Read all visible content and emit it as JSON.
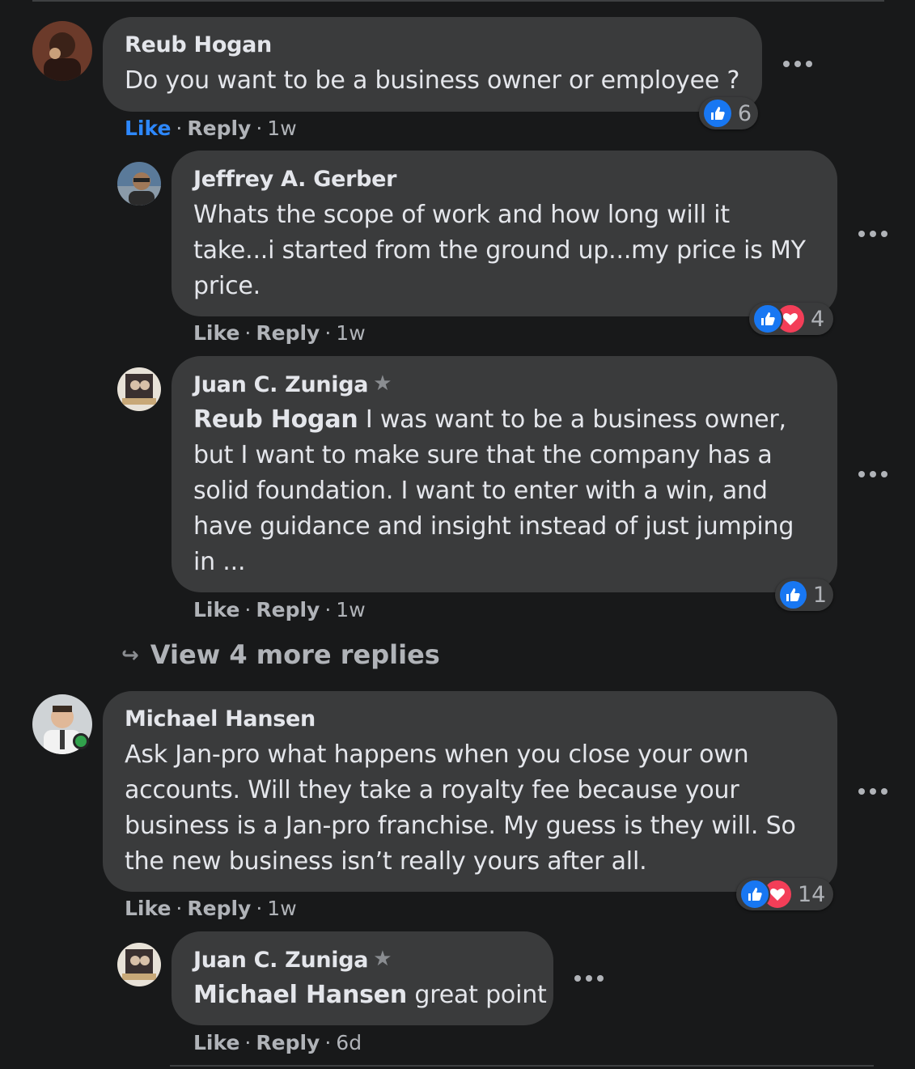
{
  "comments": [
    {
      "author": "Reub Hogan",
      "text": "Do you want to be a business owner or employee ?",
      "like": "Like",
      "reply": "Reply",
      "time": "1w",
      "reaction_count": "6",
      "liked": true
    },
    {
      "author": "Jeffrey A. Gerber",
      "text": "Whats the scope of work and how long will it take...i started from the ground up...my price is MY price.",
      "like": "Like",
      "reply": "Reply",
      "time": "1w",
      "reaction_count": "4"
    },
    {
      "author": "Juan C. Zuniga",
      "mention": "Reub Hogan",
      "text": " I was want to be a business owner, but I want to make sure that the company has a solid foundation. I want to enter with a win, and have guidance and insight instead of just jumping in ...",
      "like": "Like",
      "reply": "Reply",
      "time": "1w",
      "reaction_count": "1"
    },
    {
      "author": "Michael Hansen",
      "text": "Ask Jan-pro what happens when you close your own accounts. Will they take a royalty fee because your business is a Jan-pro franchise. My guess is they will. So the new business isn’t really yours after all.",
      "like": "Like",
      "reply": "Reply",
      "time": "1w",
      "reaction_count": "14"
    },
    {
      "author": "Juan C. Zuniga",
      "mention": "Michael Hansen",
      "text": " great point",
      "like": "Like",
      "reply": "Reply",
      "time": "6d"
    }
  ],
  "view_more_replies": "View 4 more replies",
  "colors": {
    "background": "#18191a",
    "bubble": "#3a3b3c",
    "like_blue": "#1877f2",
    "love_red": "#f33e58",
    "online_green": "#31a24c"
  },
  "icons": [
    "more-options-icon",
    "like-reaction-icon",
    "love-reaction-icon",
    "top-fan-star-icon",
    "reply-arrow-icon"
  ]
}
